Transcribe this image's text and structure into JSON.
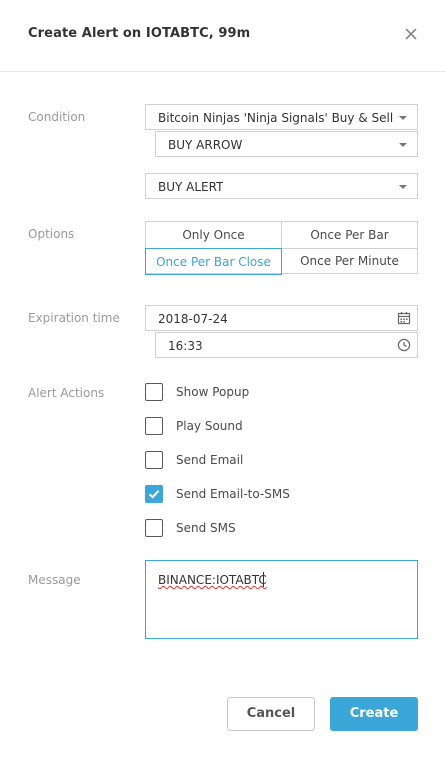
{
  "dialog": {
    "title": "Create Alert on IOTABTC, 99m"
  },
  "condition": {
    "label": "Condition",
    "indicator": "Bitcoin Ninjas 'Ninja Signals' Buy & Sell...",
    "signal": "BUY ARROW",
    "alert": "BUY ALERT"
  },
  "options": {
    "label": "Options",
    "buttons": [
      "Only Once",
      "Once Per Bar",
      "Once Per Bar Close",
      "Once Per Minute"
    ],
    "selected": "Once Per Bar Close"
  },
  "expiration": {
    "label": "Expiration time",
    "date": "2018-07-24",
    "time": "16:33"
  },
  "alert_actions": {
    "label": "Alert Actions",
    "items": [
      {
        "label": "Show Popup",
        "checked": false
      },
      {
        "label": "Play Sound",
        "checked": false
      },
      {
        "label": "Send Email",
        "checked": false
      },
      {
        "label": "Send Email-to-SMS",
        "checked": true
      },
      {
        "label": "Send SMS",
        "checked": false
      }
    ]
  },
  "message": {
    "label": "Message",
    "value": "BINANCE:IOTABTC"
  },
  "footer": {
    "cancel_label": "Cancel",
    "create_label": "Create"
  },
  "colors": {
    "accent": "#3ba6d8",
    "label": "#9a9a9a",
    "border": "#d0d0d0"
  },
  "icons": [
    "close-icon",
    "caret-down-icon",
    "calendar-icon",
    "clock-icon",
    "checkmark-icon"
  ]
}
